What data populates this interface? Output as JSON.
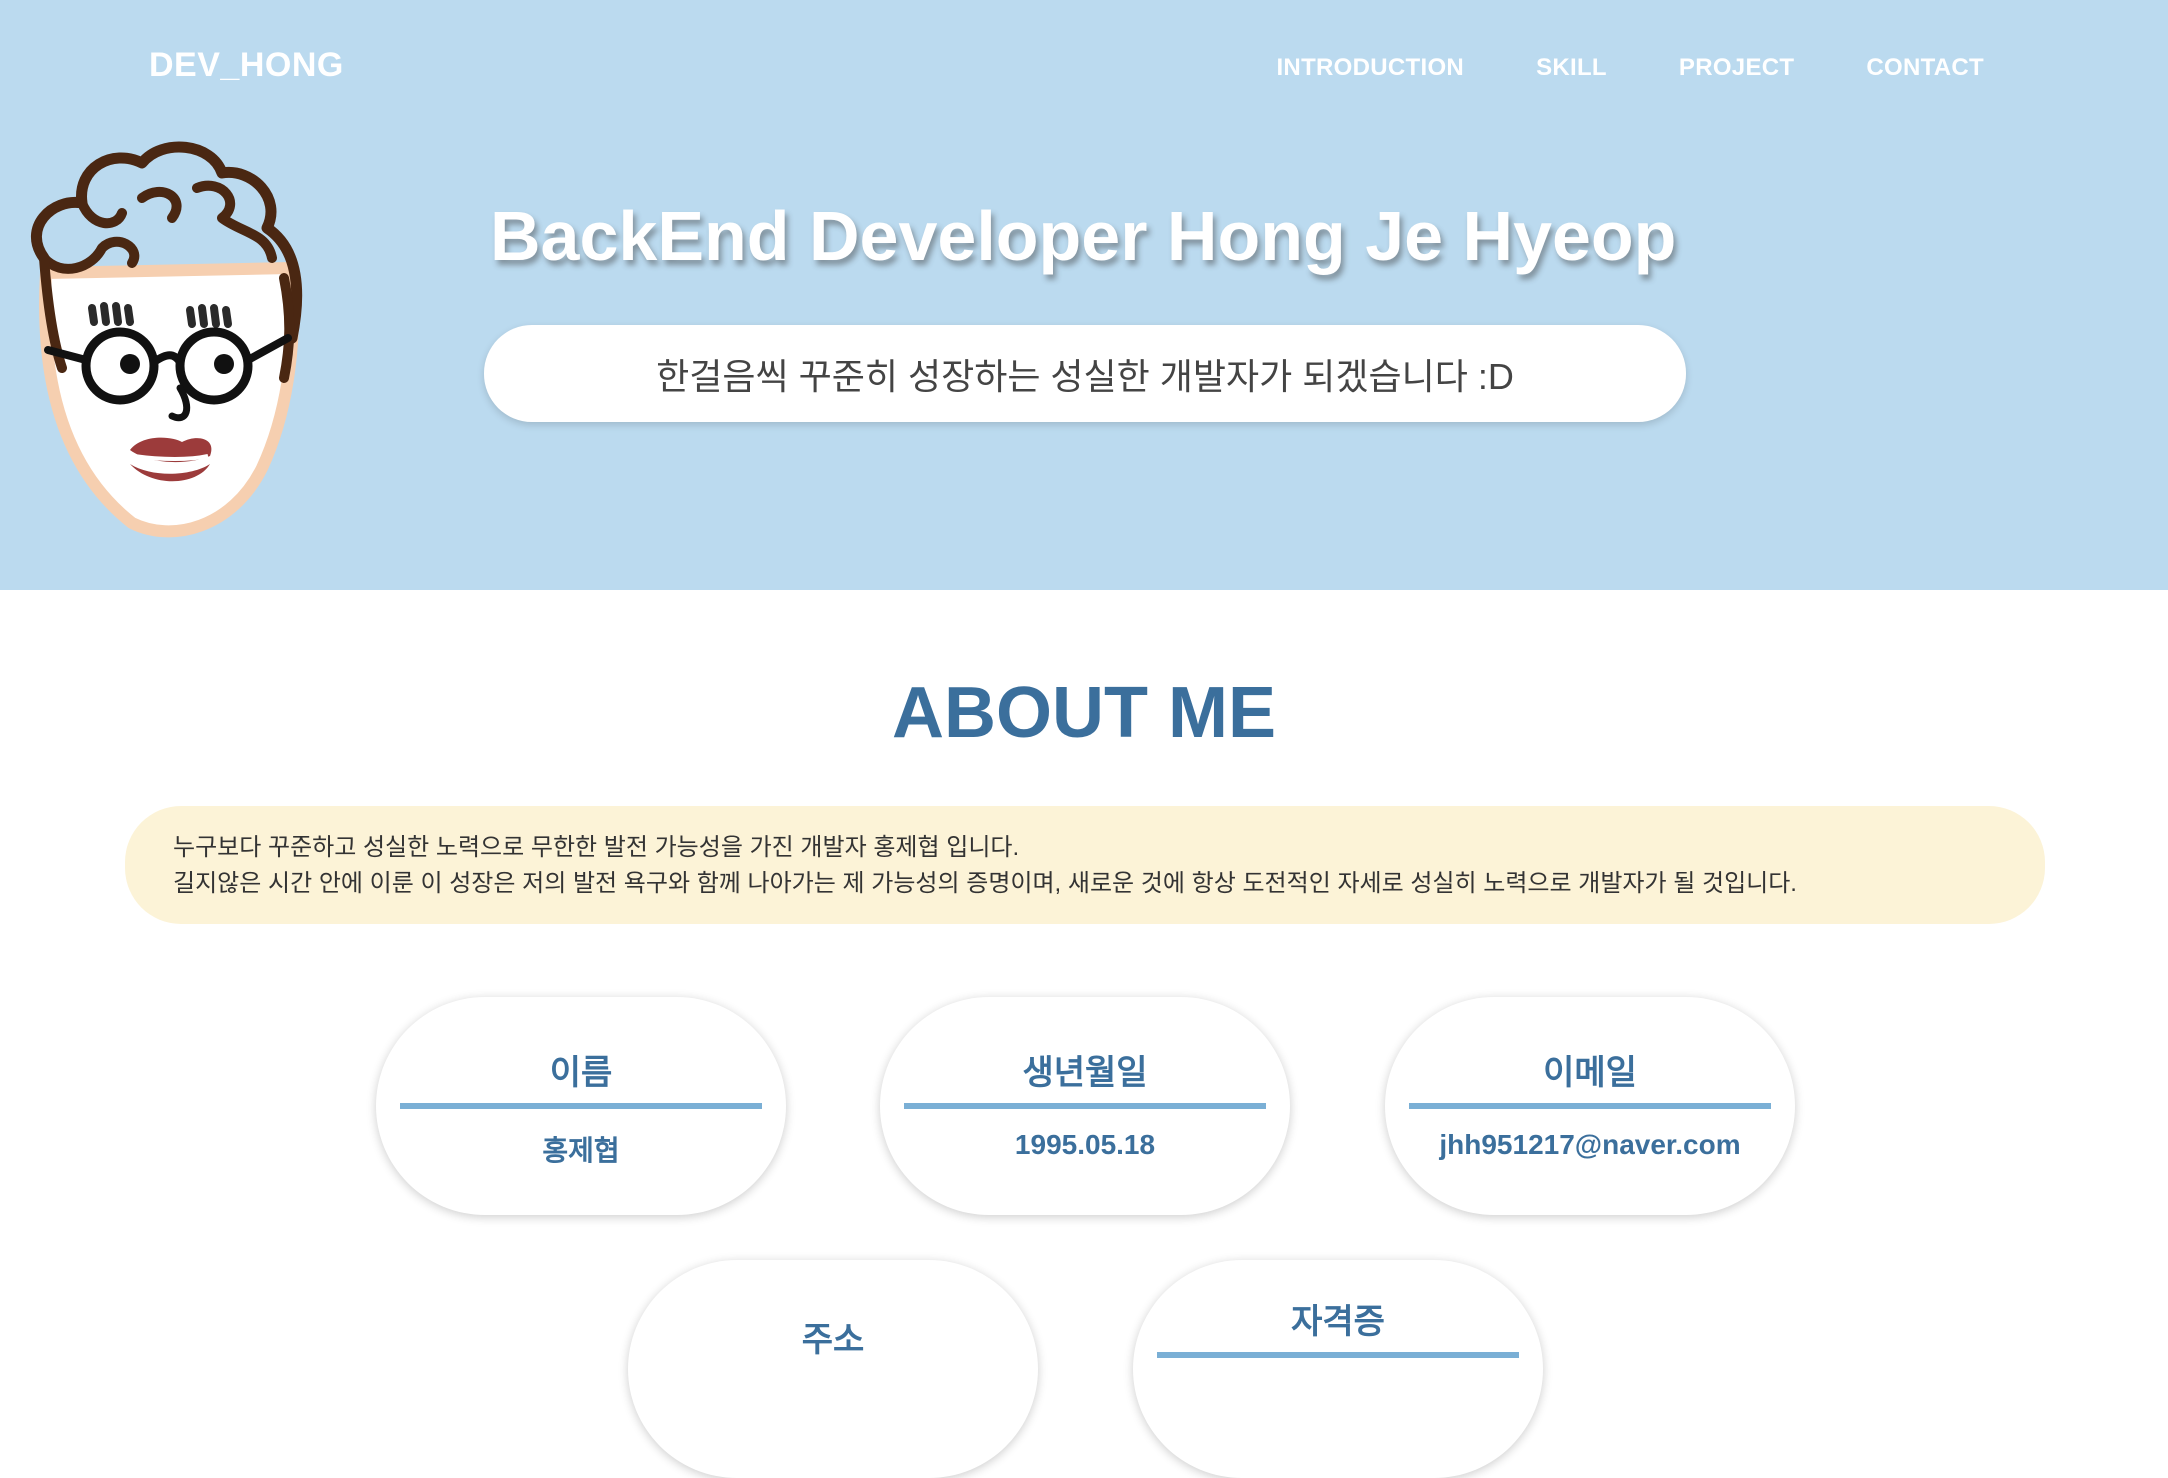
{
  "header": {
    "logo": "DEV_HONG",
    "nav": [
      "INTRODUCTION",
      "SKILL",
      "PROJECT",
      "CONTACT"
    ]
  },
  "hero": {
    "title": "BackEnd Developer Hong Je Hyeop",
    "tagline": "한걸음씩 꾸준히 성장하는 성실한 개발자가 되겠습니다 :D",
    "avatar_icon": "cartoon-avatar-icon"
  },
  "about": {
    "title": "ABOUT ME",
    "intro_line1": "누구보다 꾸준하고 성실한 노력으로 무한한 발전 가능성을 가진 개발자 홍제협 입니다.",
    "intro_line2": "길지않은 시간 안에 이룬 이 성장은 저의 발전 욕구와 함께 나아가는 제 가능성의 증명이며, 새로운 것에 항상 도전적인 자세로 성실히 노력으로 개발자가 될 것입니다.",
    "cards": [
      {
        "label": "이름",
        "value": "홍제협"
      },
      {
        "label": "생년월일",
        "value": "1995.05.18"
      },
      {
        "label": "이메일",
        "value": "jhh951217@naver.com"
      },
      {
        "label": "주소",
        "value": ""
      },
      {
        "label": "자격증",
        "value": ""
      }
    ]
  },
  "colors": {
    "hero_bg": "#bbdaef",
    "accent": "#3b6f9c",
    "intro_bg": "#fcf3d7",
    "divider": "#7aafd5"
  }
}
